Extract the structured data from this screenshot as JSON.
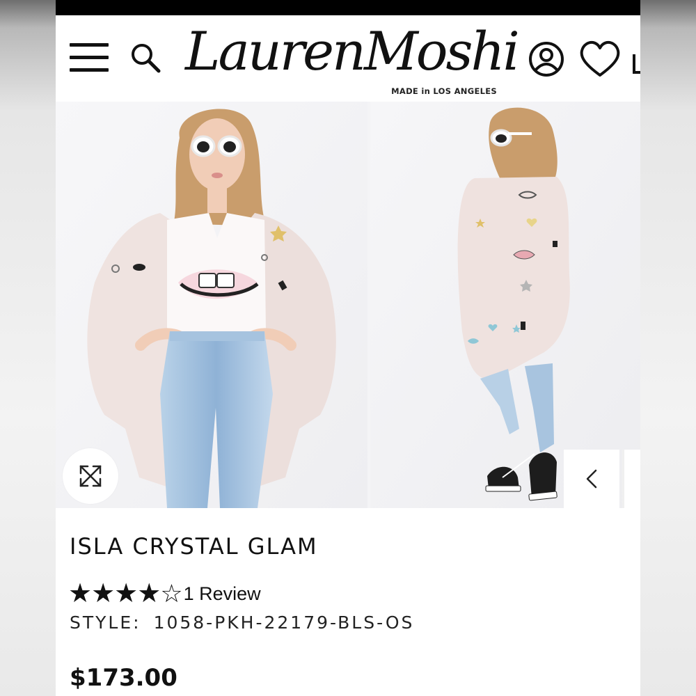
{
  "brand": {
    "logo_text": "LaurenMoshi",
    "tagline": "MADE in LOS ANGELES"
  },
  "header": {
    "icons": [
      "menu-icon",
      "search-icon",
      "account-icon",
      "heart-icon",
      "bag-icon"
    ]
  },
  "gallery": {
    "images": [
      {
        "name": "front-view",
        "description_icon": "model-photo"
      },
      {
        "name": "back-view",
        "description_icon": "model-photo"
      }
    ],
    "expand_icon": "expand-arrows-icon",
    "prev_icon": "chevron-left-icon"
  },
  "product": {
    "title": "ISLA CRYSTAL GLAM",
    "rating": 4,
    "rating_max": 5,
    "review_text": "1 Review",
    "style_label": "STYLE:",
    "style_value": "1058-PKH-22179-BLS-OS",
    "price": "$173.00"
  },
  "colors": {
    "text": "#111111",
    "background": "#ffffff",
    "cardigan": "#efe2e0",
    "denim": "#a9c6e0"
  }
}
